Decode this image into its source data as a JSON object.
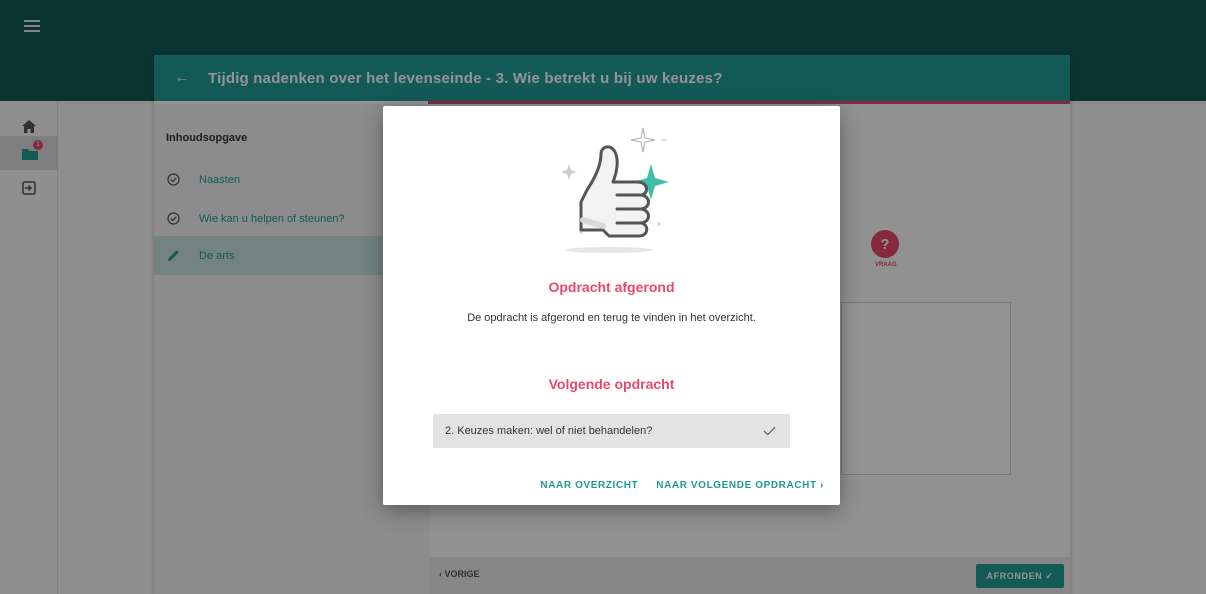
{
  "app": {
    "menu_icon": "hamburger-icon"
  },
  "rail": {
    "items": [
      {
        "icon": "home-icon"
      },
      {
        "icon": "folder-icon",
        "badge": "1"
      },
      {
        "icon": "logout-icon"
      }
    ]
  },
  "panel": {
    "back_icon": "arrow-left-icon",
    "title": "Tijdig nadenken over het levenseinde - 3. Wie betrekt u bij uw keuzes?"
  },
  "toc": {
    "title": "Inhoudsopgave",
    "items": [
      {
        "label": "Naasten",
        "icon": "check-circle-icon"
      },
      {
        "label": "Wie kan u helpen of steunen?",
        "icon": "check-circle-icon"
      },
      {
        "label": "De arts",
        "icon": "pencil-icon"
      }
    ]
  },
  "content": {
    "help_symbol": "?",
    "help_label": "VRAAG"
  },
  "footer": {
    "prev_label": "‹ VORIGE",
    "finish_label": "AFRONDEN ✓"
  },
  "modal": {
    "title": "Opdracht afgerond",
    "text": "De opdracht is afgerond en terug te vinden in het overzicht.",
    "next_title": "Volgende opdracht",
    "next_task": "2. Keuzes maken: wel of niet behandelen?",
    "overview_button": "NAAR OVERZICHT",
    "next_button": "NAAR VOLGENDE OPDRACHT ›"
  },
  "colors": {
    "topbar": "#115a52",
    "teal": "#229a93",
    "pink": "#e8486c"
  }
}
